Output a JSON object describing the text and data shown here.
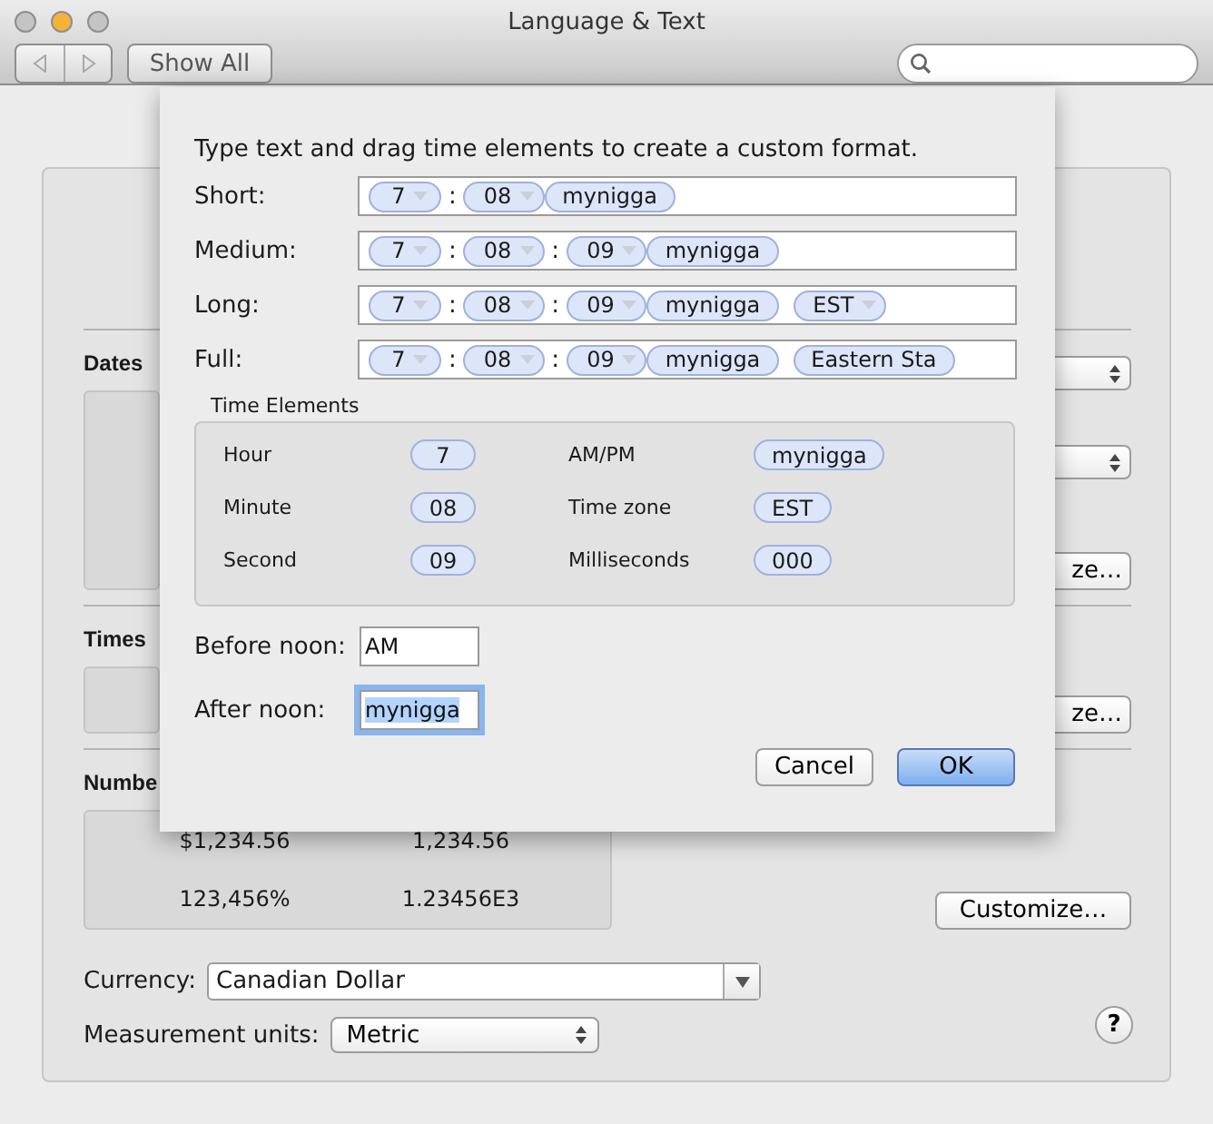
{
  "window": {
    "title": "Language & Text",
    "lights": [
      {
        "color": "#c4c4c4"
      },
      {
        "color": "#f2b338"
      },
      {
        "color": "#c4c4c4"
      }
    ]
  },
  "toolbar": {
    "nav": [
      {
        "kind": "back",
        "disabled": true
      },
      {
        "kind": "forward",
        "disabled": true
      }
    ],
    "show_all": "Show All"
  },
  "sections": [
    {
      "title": "Dates",
      "right": [
        {
          "kind": "popup"
        },
        {
          "kind": "popup"
        },
        {
          "kind": "button",
          "label": "ze…"
        }
      ]
    },
    {
      "title": "Times",
      "right": [
        {
          "kind": "button",
          "label": "ze…"
        }
      ]
    },
    {
      "title": "Numbe",
      "values": [
        "$1,234.56",
        "1,234.56",
        "123,456%",
        "1.23456E3"
      ],
      "right": [
        {
          "kind": "button",
          "label": "Customize…"
        }
      ]
    }
  ],
  "currency": {
    "label": "Currency:",
    "value": "Canadian Dollar"
  },
  "measurement": {
    "label": "Measurement units:",
    "value": "Metric"
  },
  "help": "?",
  "sheet": {
    "instructions": "Type text and drag time elements to create a custom format.",
    "formats": [
      {
        "label": "Short:",
        "tokens": [
          {
            "kind": "menu",
            "text": "7"
          },
          {
            "kind": "sep",
            "text": ":"
          },
          {
            "kind": "menu",
            "text": "08"
          },
          {
            "kind": "pill",
            "text": "mynigga"
          }
        ]
      },
      {
        "label": "Medium:",
        "tokens": [
          {
            "kind": "menu",
            "text": "7"
          },
          {
            "kind": "sep",
            "text": ":"
          },
          {
            "kind": "menu",
            "text": "08"
          },
          {
            "kind": "sep",
            "text": ":"
          },
          {
            "kind": "menu",
            "text": "09"
          },
          {
            "kind": "pill",
            "text": "mynigga"
          }
        ]
      },
      {
        "label": "Long:",
        "tokens": [
          {
            "kind": "menu",
            "text": "7"
          },
          {
            "kind": "sep",
            "text": ":"
          },
          {
            "kind": "menu",
            "text": "08"
          },
          {
            "kind": "sep",
            "text": ":"
          },
          {
            "kind": "menu",
            "text": "09"
          },
          {
            "kind": "pill",
            "text": "mynigga"
          },
          {
            "kind": "menu",
            "text": "EST"
          }
        ]
      },
      {
        "label": "Full:",
        "tokens": [
          {
            "kind": "menu",
            "text": "7"
          },
          {
            "kind": "sep",
            "text": ":"
          },
          {
            "kind": "menu",
            "text": "08"
          },
          {
            "kind": "sep",
            "text": ":"
          },
          {
            "kind": "menu",
            "text": "09"
          },
          {
            "kind": "pill",
            "text": "mynigga"
          },
          {
            "kind": "pill",
            "text": "Eastern Sta"
          }
        ]
      }
    ],
    "time_elements": {
      "title": "Time Elements",
      "items": [
        {
          "label": "Hour",
          "value": "7"
        },
        {
          "label": "AM/PM",
          "value": "mynigga"
        },
        {
          "label": "Minute",
          "value": "08"
        },
        {
          "label": "Time zone",
          "value": "EST"
        },
        {
          "label": "Second",
          "value": "09"
        },
        {
          "label": "Milliseconds",
          "value": "000"
        }
      ]
    },
    "before_noon": {
      "label": "Before noon:",
      "value": "AM",
      "focused": false
    },
    "after_noon": {
      "label": "After noon:",
      "value": "mynigga",
      "focused": true
    },
    "buttons": [
      {
        "label": "Cancel",
        "default": false
      },
      {
        "label": "OK",
        "default": true
      }
    ]
  }
}
